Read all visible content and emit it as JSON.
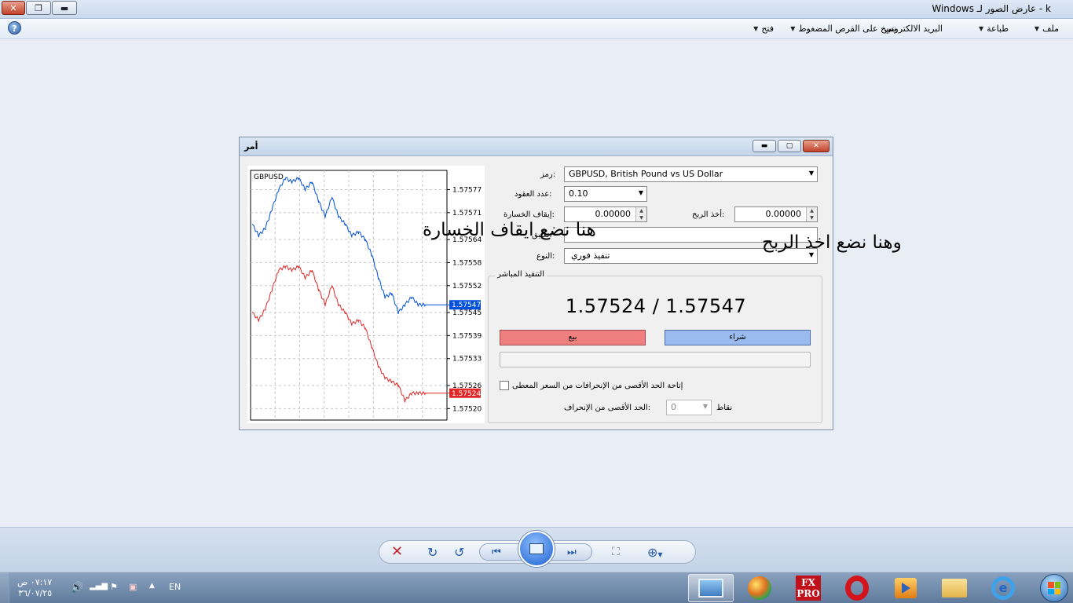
{
  "window": {
    "title": "k - عارض الصور لـ Windows"
  },
  "menu": {
    "items": [
      {
        "label": "ملف",
        "has_caret": true
      },
      {
        "label": "طباعة",
        "has_caret": true
      },
      {
        "label": "البريد الالكتروني",
        "has_caret": false
      },
      {
        "label": "نسخ على القرص المضغوط",
        "has_caret": true
      },
      {
        "label": "فتح",
        "has_caret": true
      }
    ]
  },
  "dialog": {
    "title": "أمر",
    "symbol_label": ":رمز",
    "symbol_value": "GBPUSD, British Pound vs US Dollar",
    "volume_label": ":عدد العقود",
    "volume_value": "0.10",
    "stoploss_label": ":إيقاف الخسارة",
    "stoploss_value": "0.00000",
    "takeprofit_label": ":أخذ الربح",
    "takeprofit_value": "0.00000",
    "comment_label": ":تعليق",
    "type_label": ":النوع",
    "type_value": "تنفيذ فوري",
    "group_label": "التنفيذ المباشر",
    "price_text": "1.57524 / 1.57547",
    "sell_label": "بيع",
    "buy_label": "شراء",
    "deviation_check_label": "إتاحة الحد الأقصى من الإنحرافات من السعر المعطى",
    "deviation_label": ":الحد الأقصى من الإنحراف",
    "deviation_value": "0",
    "deviation_unit": "نقاط"
  },
  "annotations": {
    "stoploss": "هنا نضع ايقاف الخسارة",
    "takeprofit": "وهنا نضع اخذ الربح"
  },
  "chart_data": {
    "type": "line",
    "title": "GBPUSD",
    "ylim": [
      1.57517,
      1.57582
    ],
    "y_ticks": [
      "1.57577",
      "1.57571",
      "1.57564",
      "1.57558",
      "1.57552",
      "1.57545",
      "1.57539",
      "1.57533",
      "1.57526",
      "1.57520"
    ],
    "y_tick_values": [
      1.57577,
      1.57571,
      1.57564,
      1.57558,
      1.57552,
      1.57545,
      1.57539,
      1.57533,
      1.57526,
      1.5752
    ],
    "series": [
      {
        "role": "ask",
        "color": "#0050dc",
        "last_label": "1.57547",
        "values": [
          1.57568,
          1.57565,
          1.57567,
          1.57572,
          1.57577,
          1.5758,
          1.57579,
          1.5758,
          1.57577,
          1.57579,
          1.57574,
          1.5757,
          1.57575,
          1.5757,
          1.57568,
          1.57565,
          1.57566,
          1.57564,
          1.5756,
          1.57554,
          1.57549,
          1.5755,
          1.57545,
          1.57547,
          1.57549,
          1.57547,
          1.57547
        ]
      },
      {
        "role": "bid",
        "color": "#e02828",
        "last_label": "1.57524",
        "values": [
          1.57545,
          1.57543,
          1.57546,
          1.57551,
          1.57556,
          1.57557,
          1.57556,
          1.57557,
          1.57554,
          1.57556,
          1.57551,
          1.57547,
          1.57552,
          1.57547,
          1.57545,
          1.57542,
          1.57543,
          1.57541,
          1.57536,
          1.57531,
          1.57528,
          1.57527,
          1.57526,
          1.57522,
          1.57524,
          1.57524,
          1.57524
        ]
      }
    ],
    "grid": true
  },
  "taskbar": {
    "lang": "EN",
    "time": "٠٧:١٧ ص",
    "date": "٣٦/٠٧/٢٥",
    "fxpro_label_1": "FX",
    "fxpro_label_2": "PRO"
  },
  "colors": {
    "sell": "#f08080",
    "buy": "#99bbee",
    "accent": "#1d5fcf"
  }
}
